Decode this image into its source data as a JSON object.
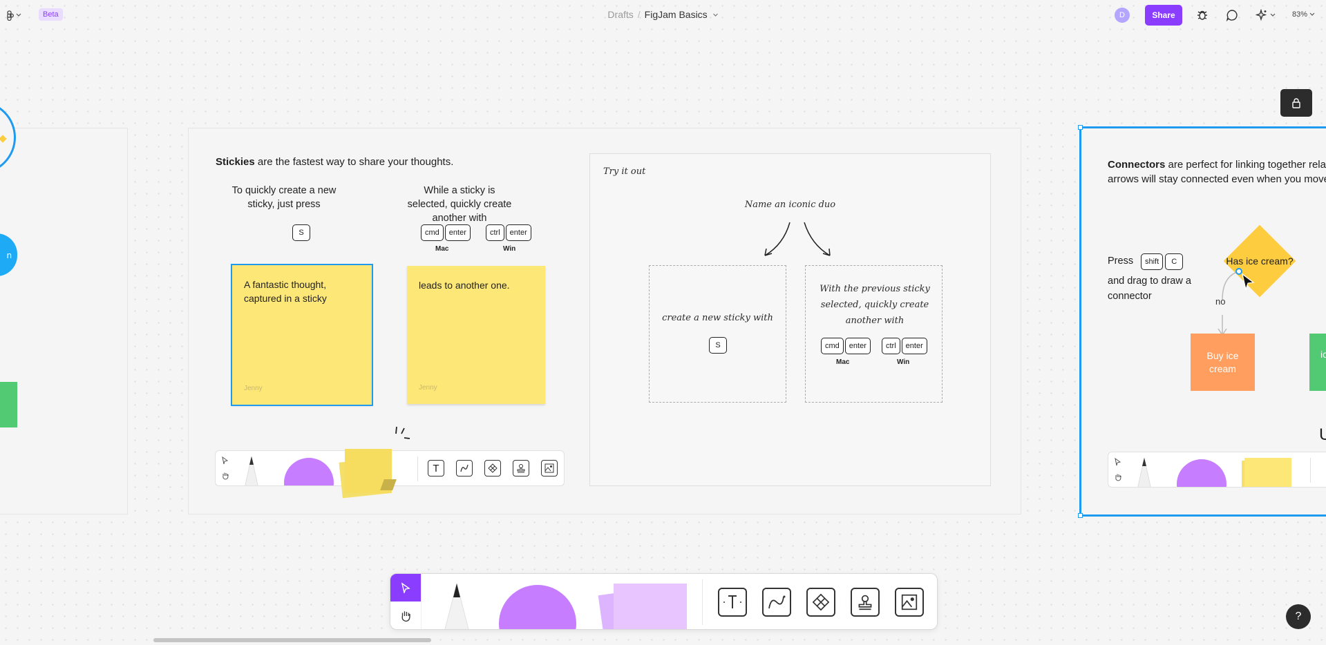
{
  "topbar": {
    "beta": "Beta",
    "breadcrumb_drafts": "Drafts",
    "breadcrumb_sep": "/",
    "file_name": "FigJam Basics",
    "avatar_initial": "D",
    "share_label": "Share",
    "zoom": "83%",
    "icons": [
      "figma-logo-icon",
      "bug-icon",
      "comment-icon",
      "sparkle-icon"
    ]
  },
  "stickies_section": {
    "heading_bold": "Stickies",
    "heading_rest": " are the fastest way to share your thoughts.",
    "left_caption": "To quickly create a new sticky, just press",
    "left_key": "S",
    "right_caption": "While a sticky is selected, quickly create another with",
    "keys_mac": [
      "cmd",
      "enter"
    ],
    "keys_win": [
      "ctrl",
      "enter"
    ],
    "mac_label": "Mac",
    "win_label": "Win",
    "sticky1_text": "A fantastic thought, captured in a sticky",
    "sticky1_author": "Jenny",
    "sticky2_text": "leads to another one.",
    "sticky2_author": "Jenny"
  },
  "try_it": {
    "label": "Try it out",
    "prompt": "Name an iconic duo",
    "box1_text": "create a new sticky with",
    "box1_key": "S",
    "box2_text": "With the previous sticky selected, quickly create another with",
    "keys_mac": [
      "cmd",
      "enter"
    ],
    "keys_win": [
      "ctrl",
      "enter"
    ],
    "mac_label": "Mac",
    "win_label": "Win"
  },
  "connectors_section": {
    "heading_bold": "Connectors",
    "heading_rest": " are perfect for linking together rela",
    "heading_line2": "arrows will stay connected even when you move",
    "press": "Press",
    "keys": [
      "shift",
      "C"
    ],
    "instruction": "and drag to draw a connector",
    "diamond": "Has ice cream?",
    "no_label": "no",
    "buy_box": "Buy ice cream",
    "green_box": "ic",
    "cut_char": "U"
  },
  "colors": {
    "accent": "#8b3dff",
    "sticky": "#fde776",
    "selection": "#1e9bf0",
    "diamond": "#fdcd3f",
    "orange_box": "#ff9e5e",
    "green_box": "#52c973",
    "circle_tool": "#c77dff"
  },
  "help_label": "?"
}
